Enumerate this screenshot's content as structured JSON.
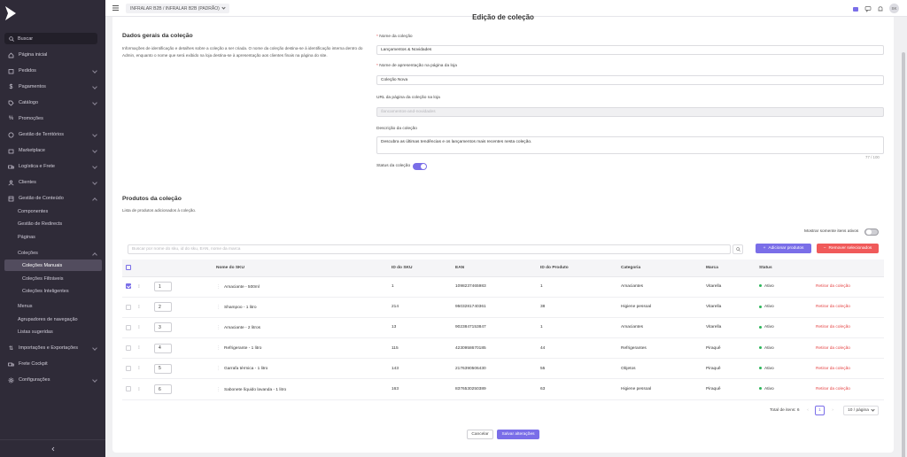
{
  "sidebar": {
    "search_label": "Buscar",
    "items": [
      {
        "label": "Página inicial"
      },
      {
        "label": "Pedidos"
      },
      {
        "label": "Pagamentos"
      },
      {
        "label": "Catálogo"
      },
      {
        "label": "Promoções"
      },
      {
        "label": "Gestão de Territórios"
      },
      {
        "label": "Marketplace"
      },
      {
        "label": "Logística e Frete"
      },
      {
        "label": "Clientes"
      },
      {
        "label": "Gestão de Conteúdo"
      },
      {
        "label": "Importações e Exportações"
      },
      {
        "label": "Frete Cockpit"
      },
      {
        "label": "Configurações"
      }
    ],
    "content_sub": [
      "Componentes",
      "Gestão de Redirects",
      "Páginas",
      "Coleções"
    ],
    "collections_sub": [
      "Coleções Manuais",
      "Coleções Filtráveis",
      "Coleções Inteligentes"
    ],
    "content_sub2": [
      "Menus",
      "Agrupadores de navegação",
      "Listas sugeridas"
    ]
  },
  "topbar": {
    "store": "INFRALAR B2B / INFRALAR B2B (PADRÃO)",
    "avatar": "SK"
  },
  "page": {
    "title": "Edição de coleção"
  },
  "general": {
    "title": "Dados gerais da coleção",
    "description": "Informações de identificação e detalhes sobre a coleção a ser criada. O nome da coleção destina-se à identificação interna dentro do Admin, enquanto o nome que será exibido na loja destina-se à apresentação aos clientes finais na página do site.",
    "name_label": "Nome da coleção",
    "name_value": "Lançamentos & Novidades",
    "display_label": "Nome de apresentação na página da loja",
    "display_value": "Coleção Nova",
    "url_label": "URL da página da coleção na loja",
    "url_placeholder": "/lancamentos-and-novidades",
    "desc_label": "Descrição da coleção",
    "desc_value": "Descubra as últimas tendências e os lançamentos mais recentes nesta coleção.",
    "char_count": "77 / 100",
    "status_label": "Status da coleção"
  },
  "products": {
    "title": "Produtos da coleção",
    "subtitle": "Lista de produtos adicionados à coleção.",
    "toggle_label": "Mostrar somente itens ativos",
    "search_placeholder": "Buscar por nome do sku, id do sku, EAN, nome da marca",
    "add_button": "Adicionar produtos",
    "remove_button": "Remover selecionados",
    "columns": [
      "Nome do SKU",
      "ID do SKU",
      "EAN",
      "ID do Produto",
      "Categoria",
      "Marca",
      "Status"
    ],
    "rows": [
      {
        "pos": "1",
        "name": "Amaciante - 500ml",
        "sku": "1",
        "ean": "1098237465983",
        "product": "1",
        "category": "Amaciantes",
        "brand": "Vitarella",
        "status": "Ativo",
        "action": "Retirar da coleção",
        "checked": true
      },
      {
        "pos": "2",
        "name": "Shampoo - 1 litro",
        "sku": "214",
        "ean": "9503281740361",
        "product": "38",
        "category": "Higiene pessoal",
        "brand": "Vitarella",
        "status": "Ativo",
        "action": "Retirar da coleção",
        "checked": false
      },
      {
        "pos": "3",
        "name": "Amaciante - 2 litros",
        "sku": "13",
        "ean": "9023847153847",
        "product": "1",
        "category": "Amaciantes",
        "brand": "Vitarella",
        "status": "Ativo",
        "action": "Retirar da coleção",
        "checked": false
      },
      {
        "pos": "4",
        "name": "Refrigerante - 1 litro",
        "sku": "115",
        "ean": "4230958670185",
        "product": "44",
        "category": "Refrigerantes",
        "brand": "Piraquê",
        "status": "Ativo",
        "action": "Retirar da coleção",
        "checked": false
      },
      {
        "pos": "5",
        "name": "Garrafa térmica - 1 litro",
        "sku": "143",
        "ean": "2176390506430",
        "product": "55",
        "category": "Objetos",
        "brand": "Piraquê",
        "status": "Ativo",
        "action": "Retirar da coleção",
        "checked": false
      },
      {
        "pos": "6",
        "name": "Sabonete líquido lavanda - 1 litro",
        "sku": "163",
        "ean": "8376530250389",
        "product": "63",
        "category": "Higiene pessoal",
        "brand": "Piraquê",
        "status": "Ativo",
        "action": "Retirar da coleção",
        "checked": false
      }
    ],
    "total_label": "Total de itens: 6",
    "current_page": "1",
    "page_size": "10 / página"
  },
  "footer": {
    "cancel": "Cancelar",
    "save": "Salvar alterações"
  },
  "colors": {
    "accent": "#7a6ee8",
    "danger": "#e54545",
    "sidebar": "#2f2b38",
    "success": "#2cb65a"
  }
}
